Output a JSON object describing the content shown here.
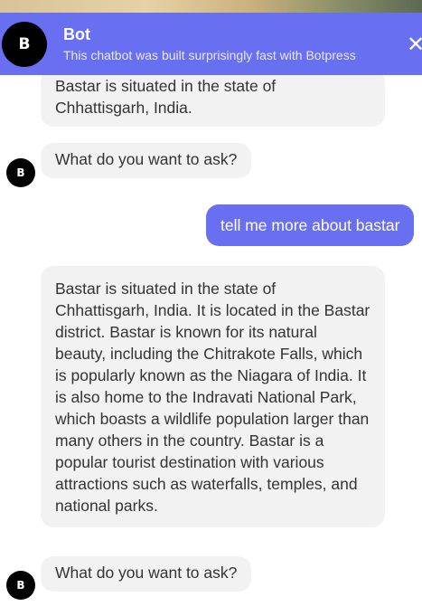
{
  "header": {
    "avatar_letter": "B",
    "title": "Bot",
    "subtitle": "This chatbot was built surprisingly fast with Botpress",
    "close_glyph": "✕"
  },
  "messages": [
    {
      "from": "bot",
      "text": "Bastar is situated in the state of Chhattisgarh, India."
    },
    {
      "from": "bot",
      "text": "What do you want to ask?",
      "avatar": "B"
    },
    {
      "from": "user",
      "text": "tell me more about bastar"
    },
    {
      "from": "bot",
      "text": "Bastar is situated in the state of Chhattisgarh, India. It is located in the Bastar district. Bastar is known for its natural beauty, including the Chitrakote Falls, which is popularly known as the Niagara of India. It is also home to the Indravati National Park, which boasts a wildlife population larger than many others in the country. Bastar is a popular tourist destination with various attractions such as waterfalls, temples, and national parks."
    },
    {
      "from": "bot",
      "text": "What do you want to ask?",
      "avatar": "B"
    }
  ],
  "colors": {
    "accent": "#6870f1",
    "bot_bubble": "#f2f2f2",
    "avatar": "#000000"
  }
}
